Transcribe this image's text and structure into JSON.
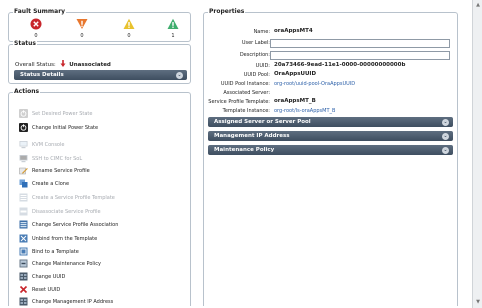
{
  "fault_summary": {
    "title": "Fault Summary",
    "items": [
      {
        "icon": "critical-fault-icon",
        "color": "#c8262c",
        "count": "0"
      },
      {
        "icon": "major-fault-icon",
        "color": "#e8772e",
        "count": "0"
      },
      {
        "icon": "minor-fault-icon",
        "color": "#e8c22e",
        "count": "0"
      },
      {
        "icon": "warning-fault-icon",
        "color": "#3fae6e",
        "count": "1"
      }
    ]
  },
  "status": {
    "title": "Status",
    "overall_label": "Overall Status:",
    "overall_value": "Unassociated",
    "details_label": "Status Details"
  },
  "actions": {
    "title": "Actions",
    "items": [
      {
        "label": "Set Desired Power State",
        "enabled": false,
        "icon": "power-icon"
      },
      {
        "label": "Change Initial Power State",
        "enabled": true,
        "icon": "power-icon"
      },
      {
        "label": "KVM Console",
        "enabled": false,
        "icon": "kvm-icon"
      },
      {
        "label": "SSH to CIMC for SoL",
        "enabled": false,
        "icon": "ssh-icon"
      },
      {
        "label": "Rename Service Profile",
        "enabled": true,
        "icon": "rename-icon"
      },
      {
        "label": "Create a Clone",
        "enabled": true,
        "icon": "clone-icon"
      },
      {
        "label": "Create a Service Profile Template",
        "enabled": false,
        "icon": "template-icon"
      },
      {
        "label": "Disassociate Service Profile",
        "enabled": false,
        "icon": "disassociate-icon"
      },
      {
        "label": "Change Service Profile Association",
        "enabled": true,
        "icon": "associate-icon"
      },
      {
        "label": "Unbind from the Template",
        "enabled": true,
        "icon": "unbind-icon"
      },
      {
        "label": "Bind to a Template",
        "enabled": true,
        "icon": "bind-icon"
      },
      {
        "label": "Change Maintenance Policy",
        "enabled": true,
        "icon": "policy-icon"
      },
      {
        "label": "Change UUID",
        "enabled": true,
        "icon": "uuid-icon"
      },
      {
        "label": "Reset UUID",
        "enabled": true,
        "icon": "reset-icon"
      },
      {
        "label": "Change Management IP Address",
        "enabled": true,
        "icon": "ip-icon"
      }
    ]
  },
  "properties": {
    "title": "Properties",
    "name_label": "Name:",
    "name_value": "oraAppsMT4",
    "user_label_label": "User Label:",
    "user_label_value": "",
    "description_label": "Description:",
    "description_value": "",
    "uuid_label": "UUID:",
    "uuid_value": "20a73466-9ead-11e1-0000-00000000000b",
    "uuid_pool_label": "UUID Pool:",
    "uuid_pool_value": "OraAppsUUID",
    "uuid_pool_instance_label": "UUID Pool Instance:",
    "uuid_pool_instance_value": "org-root/uuid-pool-OraAppsUUID",
    "associated_server_label": "Associated Server:",
    "associated_server_value": "",
    "sp_template_label": "Service Profile Template:",
    "sp_template_value": "oraAppsMT_B",
    "template_instance_label": "Template Instance:",
    "template_instance_value": "org-root/ls-oraAppsMT_B",
    "sections": [
      {
        "label": "Assigned Server or Server Pool"
      },
      {
        "label": "Management IP Address"
      },
      {
        "label": "Maintenance Policy"
      }
    ]
  }
}
